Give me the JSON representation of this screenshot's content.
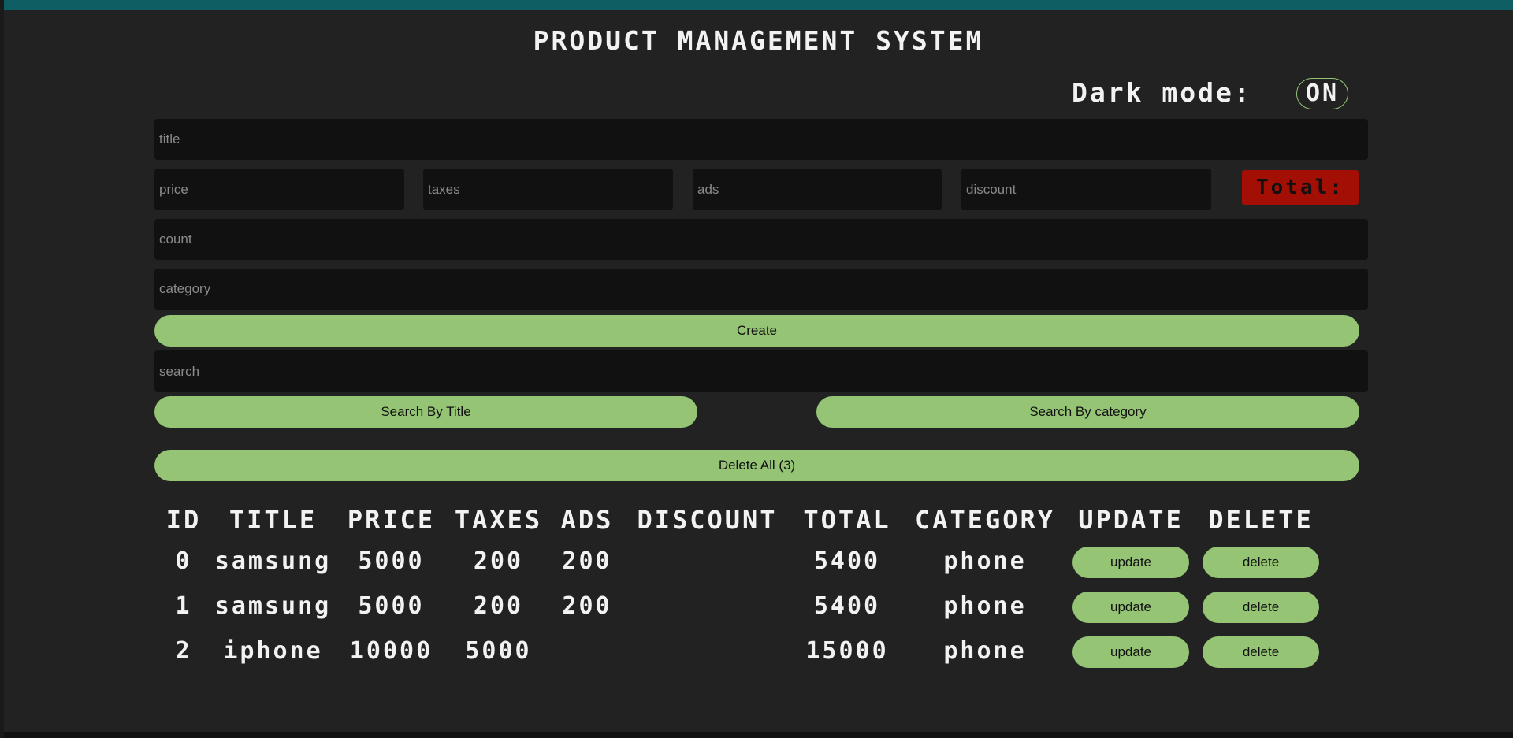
{
  "header": {
    "title": "PRODUCT MANAGEMENT SYSTEM",
    "dark_mode_label": "Dark mode:",
    "dark_mode_value": "ON"
  },
  "form": {
    "title_placeholder": "title",
    "price_placeholder": "price",
    "taxes_placeholder": "taxes",
    "ads_placeholder": "ads",
    "discount_placeholder": "discount",
    "total_label": "Total:",
    "count_placeholder": "count",
    "category_placeholder": "category",
    "create_label": "Create"
  },
  "search": {
    "placeholder": "search",
    "by_title_label": "Search By Title",
    "by_category_label": "Search By category"
  },
  "delete_all_label": "Delete All (3)",
  "table": {
    "columns": [
      "ID",
      "TITLE",
      "PRICE",
      "TAXES",
      "ADS",
      "DISCOUNT",
      "TOTAL",
      "CATEGORY",
      "UPDATE",
      "DELETE"
    ],
    "rows": [
      {
        "id": "0",
        "title": "samsung",
        "price": "5000",
        "taxes": "200",
        "ads": "200",
        "discount": "",
        "total": "5400",
        "category": "phone",
        "update": "update",
        "delete": "delete"
      },
      {
        "id": "1",
        "title": "samsung",
        "price": "5000",
        "taxes": "200",
        "ads": "200",
        "discount": "",
        "total": "5400",
        "category": "phone",
        "update": "update",
        "delete": "delete"
      },
      {
        "id": "2",
        "title": "iphone",
        "price": "10000",
        "taxes": "5000",
        "ads": "",
        "discount": "",
        "total": "15000",
        "category": "phone",
        "update": "update",
        "delete": "delete"
      }
    ]
  },
  "colors": {
    "accent": "#94c474",
    "top_bar": "#0e5e64",
    "total_bg": "#a30f05",
    "background": "#222222",
    "input_bg": "#111111"
  }
}
